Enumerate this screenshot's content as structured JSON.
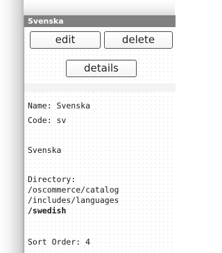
{
  "panel": {
    "title": "Svenska"
  },
  "buttons": {
    "edit_label": "edit",
    "delete_label": "delete",
    "details_label": "details"
  },
  "info": {
    "name_line": "Name: Svenska",
    "code_line": "Code: sv",
    "display_name": "Svenska",
    "directory_label": "Directory:",
    "directory_path_1": "/oscommerce/catalog",
    "directory_path_2": "/includes/languages",
    "directory_path_3": "/swedish",
    "sort_order_line": "Sort Order: 4"
  }
}
